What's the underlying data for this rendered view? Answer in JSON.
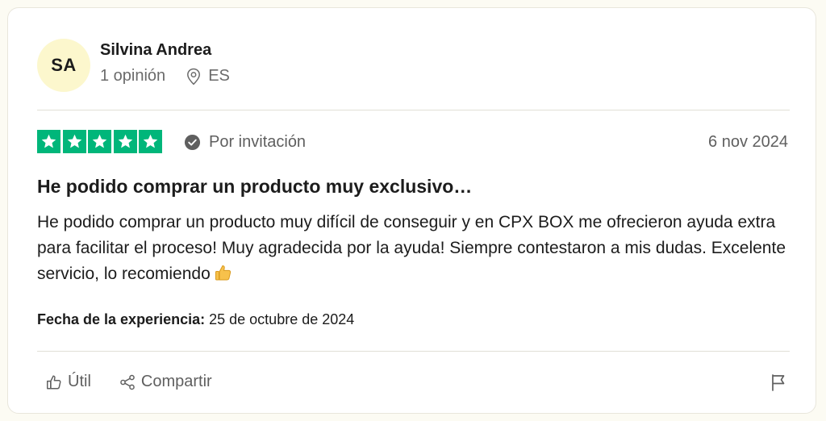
{
  "author": {
    "initials": "SA",
    "name": "Silvina Andrea",
    "reviews_count": "1 opinión",
    "country": "ES"
  },
  "review": {
    "rating": 5,
    "rating_color": "#00b67a",
    "source": "Por invitación",
    "date": "6 nov 2024",
    "title": "He podido comprar un producto muy exclusivo…",
    "body": "He podido comprar un producto muy difícil de conseguir y en CPX BOX me ofrecieron ayuda extra para facilitar el proceso! Muy agradecida por la ayuda! Siempre contestaron a mis dudas. Excelente servicio, lo recomiendo",
    "body_emoji": "thumbs-up-emoji",
    "experience_label": "Fecha de la experiencia:",
    "experience_date": "25 de octubre de 2024"
  },
  "actions": {
    "useful_label": "Útil",
    "share_label": "Compartir",
    "useful_icon": "thumbs-up-icon",
    "share_icon": "share-icon",
    "flag_icon": "flag-icon"
  }
}
